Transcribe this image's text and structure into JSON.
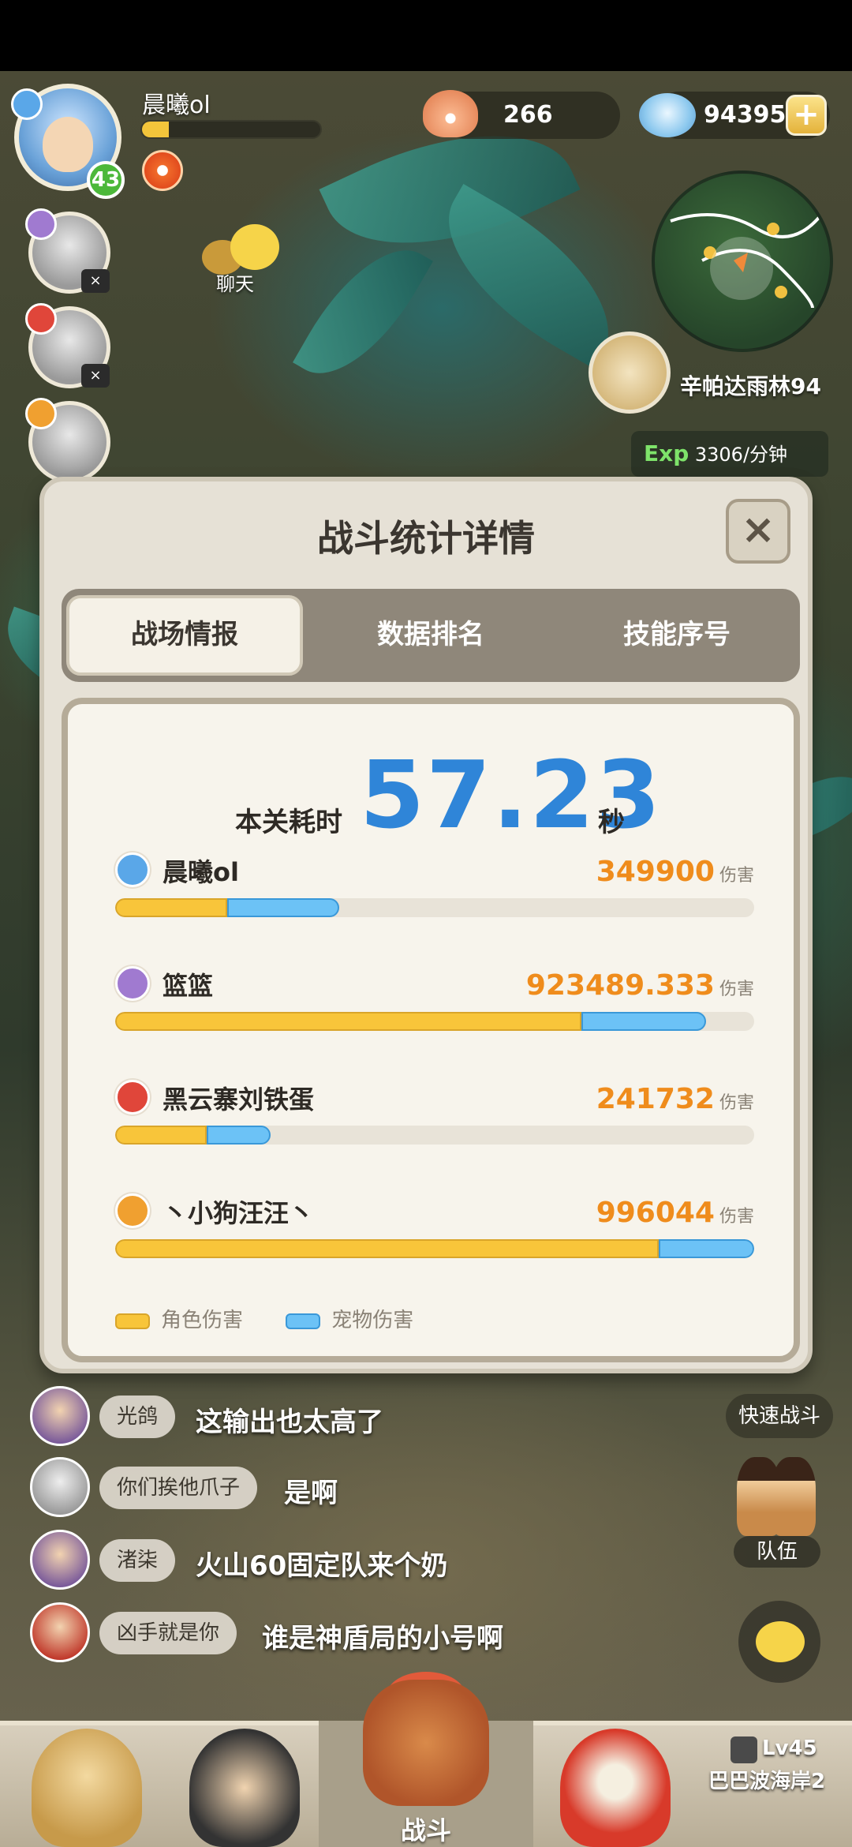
{
  "player": {
    "name": "晨曦ol",
    "level": "43",
    "xp_fraction": 0.15
  },
  "resources": {
    "shells": "266",
    "gems": "94395"
  },
  "chat_shortcut": {
    "label": "聊天"
  },
  "boss": {
    "name": "辛帕达雨林94"
  },
  "exp_rate": {
    "prefix": "Exp",
    "value": "3306/分钟"
  },
  "dialog": {
    "title": "战斗统计详情",
    "tabs": [
      {
        "label": "战场情报",
        "active": true
      },
      {
        "label": "数据排名",
        "active": false
      },
      {
        "label": "技能序号",
        "active": false
      }
    ],
    "time_label": "本关耗时",
    "time_value": "57.23",
    "time_unit": "秒",
    "damage_unit": "伤害",
    "players": [
      {
        "name": "晨曦ol",
        "damage": "349900",
        "element_color": "#5aa7e8",
        "char_fraction": 0.175,
        "pet_fraction": 0.175
      },
      {
        "name": "篮篮",
        "damage": "923489.333",
        "element_color": "#a07ad0",
        "char_fraction": 0.73,
        "pet_fraction": 0.195
      },
      {
        "name": "黑云寨刘铁蛋",
        "damage": "241732",
        "element_color": "#e0463a",
        "char_fraction": 0.143,
        "pet_fraction": 0.1
      },
      {
        "name": "丶小狗汪汪丶",
        "damage": "996044",
        "element_color": "#f0a030",
        "char_fraction": 0.85,
        "pet_fraction": 0.15
      }
    ],
    "legend": {
      "character": "角色伤害",
      "pet": "宠物伤害"
    }
  },
  "chat_messages": [
    {
      "user": "光鸽",
      "text": "这输出也太高了"
    },
    {
      "user": "你们挨他爪子",
      "text": "是啊"
    },
    {
      "user": "渚柒",
      "text": "火山60固定队来个奶"
    },
    {
      "user": "凶手就是你",
      "text": "谁是神盾局的小号啊"
    }
  ],
  "side_buttons": {
    "quick_battle": "快速战斗",
    "team": "队伍"
  },
  "bottom_nav": {
    "battle": "战斗",
    "map_level": "Lv45",
    "map_name": "巴巴波海岸2"
  },
  "colors": {
    "character_bar": "#f8c53a",
    "pet_bar": "#6cc2f6",
    "time_value": "#2f85d8",
    "damage_value": "#ef8c1c"
  }
}
